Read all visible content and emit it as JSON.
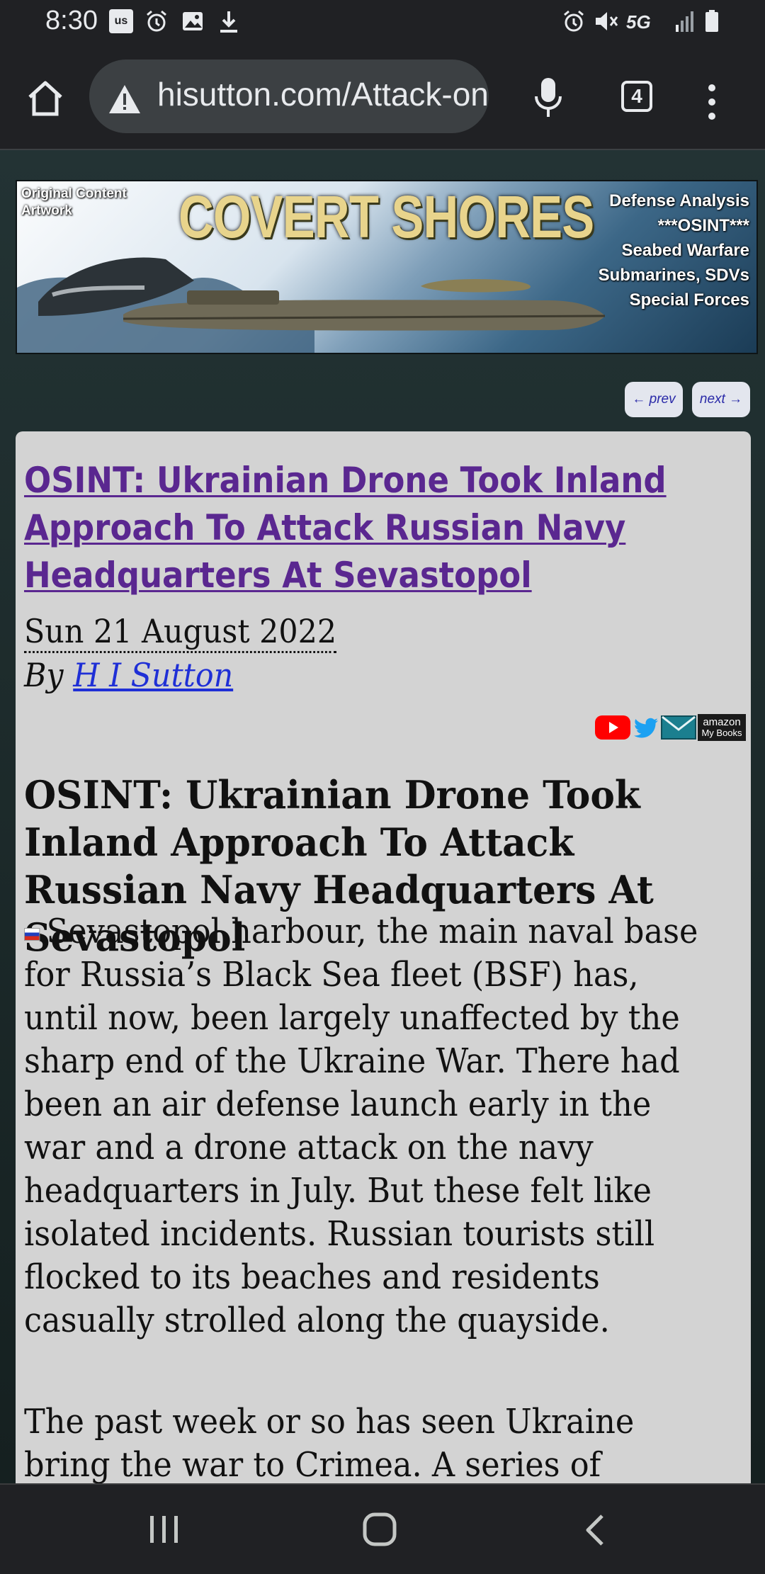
{
  "status_bar": {
    "time": "8:30",
    "carrier_badge": "us",
    "network": "5G",
    "icons": [
      "us-notification-icon",
      "alarm-icon",
      "image-icon",
      "download-icon",
      "alarm-icon",
      "mute-icon",
      "5g-icon",
      "signal-icon",
      "battery-icon"
    ]
  },
  "browser": {
    "url": "hisutton.com/Attack-on-Sevastopol",
    "tab_count": "4",
    "icons": [
      "home-icon",
      "warning-icon",
      "microphone-icon",
      "tabs-icon",
      "overflow-menu-icon"
    ]
  },
  "banner": {
    "left_text_1": "Original Content",
    "left_text_2": "Artwork",
    "title": "COVERT SHORES",
    "right_lines": [
      "Defense Analysis",
      "***OSINT***",
      "Seabed Warfare",
      "Submarines, SDVs",
      "Special Forces"
    ]
  },
  "page_nav": {
    "prev": "← prev",
    "next": "next →"
  },
  "article": {
    "title_link": "OSINT: Ukrainian Drone Took Inland Approach To Attack Russian Navy Headquarters At Sevastopol",
    "date": "Sun 21 August 2022",
    "by": "By",
    "author": "H I Sutton",
    "social": {
      "amazon_top": "amazon",
      "amazon_bottom": "My Books"
    },
    "heading": "OSINT: Ukrainian Drone Took Inland Approach To Attack Russian Navy Headquarters At Sevastopol",
    "paragraph_1": "Sevastopol harbour, the main naval base for Russia’s Black Sea fleet (BSF) has, until now, been largely unaffected by the sharp end of the Ukraine War. There had been an air defense launch early in the war and a drone attack on the navy headquarters in July. But these felt like isolated incidents. Russian tourists still flocked to its beaches and residents casually strolled along the quayside.",
    "paragraph_2": "The past week or so has seen Ukraine bring the war to Crimea. A series of"
  },
  "colors": {
    "link_visited": "#5a2790",
    "link": "#1f2fd6",
    "article_bg": "#d3d3d3",
    "chrome_bg": "#202124"
  }
}
